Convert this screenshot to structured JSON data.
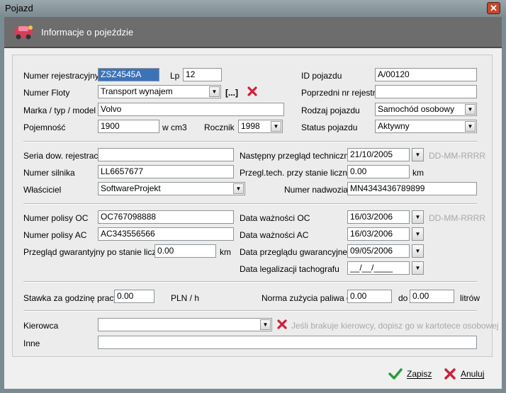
{
  "window": {
    "title": "Pojazd",
    "close": "✕"
  },
  "header": {
    "title": "Informacje o pojeździe"
  },
  "section1": {
    "nr_rej_label": "Numer rejestracyjny",
    "nr_rej_value": "ZSZ4545A",
    "lp_label": "Lp",
    "lp_value": "12",
    "id_label": "ID pojazdu",
    "id_value": "A/00120",
    "flota_label": "Numer Floty",
    "flota_value": "Transport wynajem",
    "flota_more": "[...]",
    "poprz_label": "Poprzedni nr rejestr.",
    "poprz_value": "",
    "marka_label": "Marka / typ / model",
    "marka_value": "Volvo",
    "rodzaj_label": "Rodzaj pojazdu",
    "rodzaj_value": "Samochód osobowy",
    "poj_label": "Pojemność",
    "poj_value": "1900",
    "poj_unit": "w cm3",
    "rocznik_label": "Rocznik",
    "rocznik_value": "1998",
    "status_label": "Status pojazdu",
    "status_value": "Aktywny"
  },
  "section2": {
    "seria_label": "Seria dow. rejestrac.",
    "seria_value": "",
    "przeglad_label": "Następny przegląd techniczny",
    "przeglad_value": "21/10/2005",
    "date_hint": "DD-MM-RRRR",
    "silnik_label": "Numer silnika",
    "silnik_value": "LL6657677",
    "licznik_label": "Przegl.tech. przy stanie licznika",
    "licznik_value": "0.00",
    "licznik_unit": "km",
    "wlasciciel_label": "Właściciel",
    "wlasciciel_value": "SoftwareProjekt",
    "nadwozie_label": "Numer nadwozia",
    "nadwozie_value": "MN4343436789899"
  },
  "section3": {
    "oc_label": "Numer polisy OC",
    "oc_value": "OC767098888",
    "doc_label": "Data ważności OC",
    "doc_value": "16/03/2006",
    "date_hint": "DD-MM-RRRR",
    "ac_label": "Numer polisy AC",
    "ac_value": "AC343556566",
    "dac_label": "Data ważności AC",
    "dac_value": "16/03/2006",
    "gwar_label": "Przegląd gwarantyjny po stanie licznika",
    "gwar_value": "0.00",
    "gwar_unit": "km",
    "dgwar_label": "Data przeglądu gwarancyjnego",
    "dgwar_value": "09/05/2006",
    "tacho_label": "Data legalizacji tachografu",
    "tacho_value": "__/__/____"
  },
  "section4": {
    "stawka_label": "Stawka za godzinę pracy",
    "stawka_value": "0.00",
    "stawka_unit": "PLN / h",
    "norma_label": "Norma zużycia paliwa od",
    "norma_from": "0.00",
    "do_label": "do",
    "norma_to": "0.00",
    "norma_unit": "litrów"
  },
  "section5": {
    "kierowca_label": "Kierowca",
    "kierowca_value": "",
    "kierowca_hint": "Jeśli brakuje kierowcy, dopisz go w kartotece osobowej",
    "inne_label": "Inne",
    "inne_value": ""
  },
  "footer": {
    "save_label": "Zapisz",
    "cancel_label": "Anuluj"
  },
  "icons": {
    "dropdown": "chevron-down-icon",
    "clear": "red-x-icon",
    "save": "checkmark-icon",
    "cancel": "red-x-icon",
    "header": "car-icon"
  },
  "colors": {
    "selection": "#3b73b9",
    "clear_red": "#d0203a",
    "save_green": "#2e9a3a"
  }
}
